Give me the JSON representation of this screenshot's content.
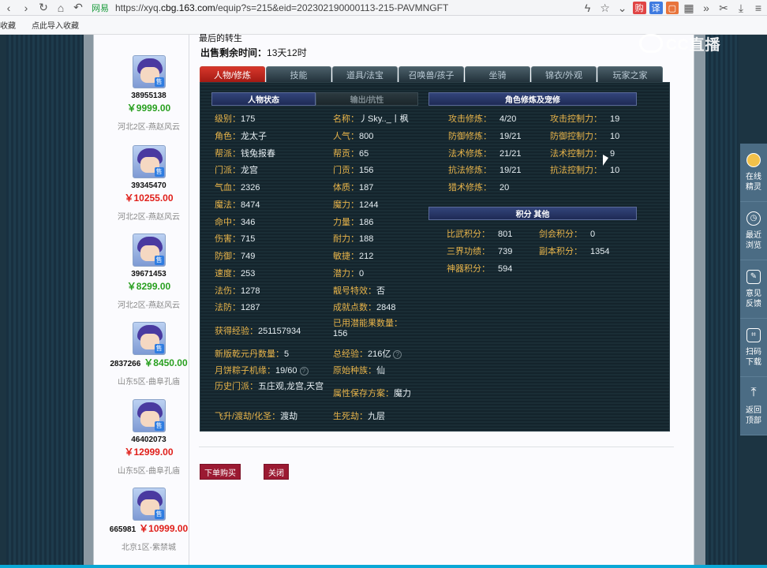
{
  "browser": {
    "security": "网易",
    "url_prefix": "https://xyq.",
    "url_host": "cbg.163.com",
    "url_path": "/equip?s=215&eid=202302190000113-215-PAVMNGFT",
    "badges": [
      "购",
      "译",
      "▢"
    ],
    "bookmarks": [
      "收藏",
      "点此导入收藏"
    ]
  },
  "overlay": {
    "brand": "CC直播"
  },
  "sale": {
    "cut_text": "最后的转生 ",
    "time_label": "出售剩余时间：",
    "time_value": "13天12时"
  },
  "tabs": [
    {
      "label": "人物/修炼",
      "active": true
    },
    {
      "label": "技能",
      "active": false
    },
    {
      "label": "道具/法宝",
      "active": false
    },
    {
      "label": "召唤兽/孩子",
      "active": false
    },
    {
      "label": "坐骑",
      "active": false
    },
    {
      "label": "锦衣/外观",
      "active": false
    },
    {
      "label": "玩家之家",
      "active": false
    }
  ],
  "sections": {
    "status": "人物状态",
    "output": "输出/抗性",
    "cultivation": "角色修炼及宠修",
    "points": "积分  其他"
  },
  "left_stats": [
    {
      "k": "级别：",
      "v": "175"
    },
    {
      "k": "角色：",
      "v": "龙太子"
    },
    {
      "k": "帮派：",
      "v": "钱兔报春"
    },
    {
      "k": "门派：",
      "v": "龙宫"
    },
    {
      "k": "气血：",
      "v": "2326"
    },
    {
      "k": "魔法：",
      "v": "8474"
    },
    {
      "k": "命中：",
      "v": "346"
    },
    {
      "k": "伤害：",
      "v": "715"
    },
    {
      "k": "防御：",
      "v": "749"
    },
    {
      "k": "速度：",
      "v": "253"
    },
    {
      "k": "法伤：",
      "v": "1278"
    },
    {
      "k": "法防：",
      "v": "1287"
    }
  ],
  "right_stats": [
    {
      "k": "名称：",
      "v": "丿Sky.._丨枫"
    },
    {
      "k": "人气：",
      "v": "800"
    },
    {
      "k": "帮贡：",
      "v": "65"
    },
    {
      "k": "门贡：",
      "v": "156"
    },
    {
      "k": "体质：",
      "v": "187"
    },
    {
      "k": "魔力：",
      "v": "1244"
    },
    {
      "k": "力量：",
      "v": "186"
    },
    {
      "k": "耐力：",
      "v": "188"
    },
    {
      "k": "敏捷：",
      "v": "212"
    },
    {
      "k": "潜力：",
      "v": "0"
    },
    {
      "k": "靓号特效：",
      "v": "否"
    },
    {
      "k": "成就点数：",
      "v": "2848"
    }
  ],
  "extra_stats": {
    "exp_k": "获得经验：",
    "exp_v": "251157934",
    "qian_k": "已用潜能果数量：",
    "qian_v": "156",
    "qyd_k": "新版乾元丹数量：",
    "qyd_v": "5",
    "total_k": "总经验：",
    "total_v": "216亿",
    "yue_k": "月饼粽子机缘：",
    "yue_v": "19/60",
    "race_k": "原始种族：",
    "race_v": "仙",
    "hist_k": "历史门派：",
    "hist_v": "五庄观,龙宫,天宫",
    "save_k": "属性保存方案：",
    "save_v": "魔力",
    "fly_k": "飞升/渡劫/化圣：",
    "fly_v": "渡劫",
    "life_k": "生死劫：",
    "life_v": "九层"
  },
  "cultivation_left": [
    {
      "k": "攻击修炼：",
      "v": "4/20"
    },
    {
      "k": "防御修炼：",
      "v": "19/21"
    },
    {
      "k": "法术修炼：",
      "v": "21/21"
    },
    {
      "k": "抗法修炼：",
      "v": "19/21"
    },
    {
      "k": "猎术修炼：",
      "v": "20"
    }
  ],
  "cultivation_right": [
    {
      "k": "攻击控制力：",
      "v": "19"
    },
    {
      "k": "防御控制力：",
      "v": "10"
    },
    {
      "k": "法术控制力：",
      "v": "9"
    },
    {
      "k": "抗法控制力：",
      "v": "10"
    }
  ],
  "points_left": [
    {
      "k": "比武积分：",
      "v": "801"
    },
    {
      "k": "三界功绩：",
      "v": "739"
    },
    {
      "k": "神器积分：",
      "v": "594"
    }
  ],
  "points_right": [
    {
      "k": "剑会积分：",
      "v": "0"
    },
    {
      "k": "副本积分：",
      "v": "1354"
    }
  ],
  "buttons": {
    "buy": "下单购买",
    "close": "关闭"
  },
  "listings": [
    {
      "id": "38955138",
      "price": "￥9999.00",
      "color": "green",
      "server": "河北2区-燕赵风云"
    },
    {
      "id": "39345470",
      "price": "￥10255.00",
      "color": "red",
      "server": "河北2区-燕赵风云"
    },
    {
      "id": "39671453",
      "price": "￥8299.00",
      "color": "green",
      "server": "河北2区-燕赵风云"
    },
    {
      "id": "2837266",
      "price": "￥8450.00",
      "color": "green",
      "server": "山东5区-曲阜孔庙"
    },
    {
      "id": "46402073",
      "price": "￥12999.00",
      "color": "red",
      "server": "山东5区-曲阜孔庙"
    },
    {
      "id": "665981",
      "price": "￥10999.00",
      "color": "red",
      "server": "北京1区-紫禁城"
    }
  ],
  "side_tools": [
    {
      "label1": "在线",
      "label2": "精灵",
      "icon": "helper-icon"
    },
    {
      "label1": "最近",
      "label2": "浏览",
      "icon": "clock-icon"
    },
    {
      "label1": "意见",
      "label2": "反馈",
      "icon": "edit-icon"
    },
    {
      "label1": "扫码",
      "label2": "下载",
      "icon": "qrcode-icon"
    },
    {
      "label1": "返回",
      "label2": "顶部",
      "icon": "back-top-icon"
    }
  ]
}
